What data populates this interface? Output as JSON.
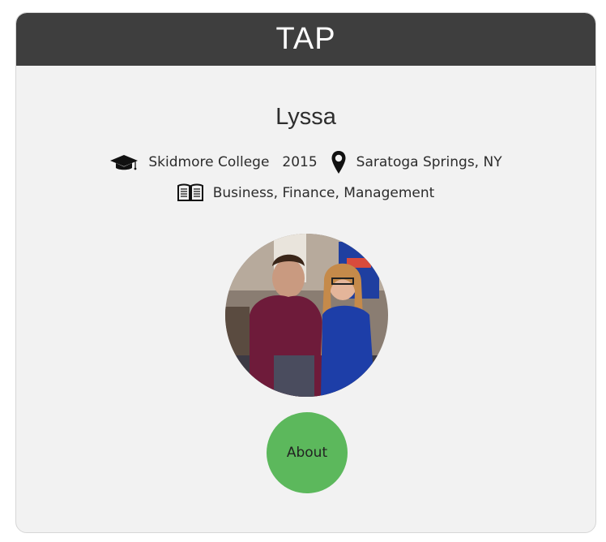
{
  "header": {
    "title": "TAP"
  },
  "profile": {
    "name": "Lyssa",
    "school": "Skidmore College",
    "year": "2015",
    "location": "Saratoga Springs, NY",
    "interests": "Business, Finance, Management",
    "icons": {
      "school": "graduation-cap-icon",
      "location": "map-pin-icon",
      "interests": "open-book-icon"
    }
  },
  "about_button": {
    "label": "About"
  },
  "colors": {
    "header_bg": "#3e3e3e",
    "card_bg": "#f2f2f2",
    "about_button_bg": "#5cb85c"
  }
}
